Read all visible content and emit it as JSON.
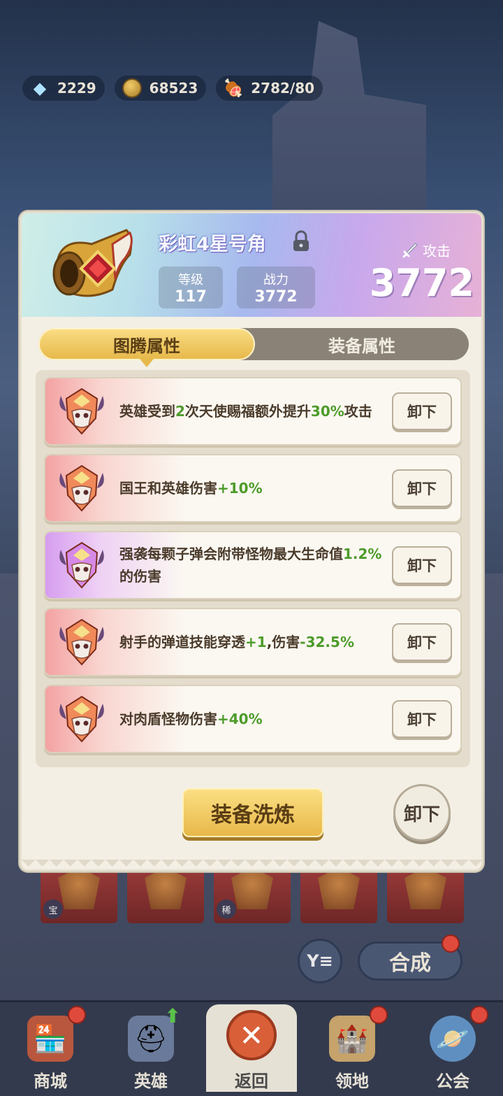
{
  "resources": {
    "gems": "2229",
    "coins": "68523",
    "stamina": "2782/80"
  },
  "item": {
    "name": "彩虹4星号角",
    "level_label": "等级",
    "level": "117",
    "power_label": "战力",
    "power": "3772",
    "attack_label": "攻击",
    "attack": "3772"
  },
  "tabs": [
    {
      "label": "图腾属性",
      "active": true
    },
    {
      "label": "装备属性",
      "active": false
    }
  ],
  "totems": [
    {
      "rarity": "red",
      "parts": [
        "英雄受到",
        "2",
        "次天使赐福额外提升",
        "30%",
        "攻击"
      ],
      "button": "卸下"
    },
    {
      "rarity": "red",
      "parts": [
        "国王和英雄伤害",
        "+10%"
      ],
      "button": "卸下"
    },
    {
      "rarity": "purple",
      "parts": [
        "强袭每颗子弹会附带怪物最大生命值",
        "1.2%",
        "的伤害"
      ],
      "button": "卸下"
    },
    {
      "rarity": "red",
      "parts": [
        "射手的弹道技能穿透",
        "+1",
        ",伤害",
        "-32.5%"
      ],
      "button": "卸下"
    },
    {
      "rarity": "red",
      "parts": [
        "对肉盾怪物伤害",
        "+40%"
      ],
      "button": "卸下"
    }
  ],
  "actions": {
    "refine": "装备洗炼",
    "unequip": "卸下"
  },
  "inventory": {
    "tags": [
      "宝",
      "",
      "稀",
      "",
      ""
    ],
    "merge": "合成"
  },
  "nav": [
    {
      "label": "商城",
      "icon": "shop-icon"
    },
    {
      "label": "英雄",
      "icon": "hero-helmet-icon"
    },
    {
      "label": "返回",
      "icon": "close-icon"
    },
    {
      "label": "领地",
      "icon": "castle-icon"
    },
    {
      "label": "公会",
      "icon": "planet-icon"
    }
  ],
  "colors": {
    "highlight_green": "#4d9b2a",
    "accent_gold": "#e8b84a",
    "rarity_red": "#f3a2a2",
    "rarity_purple": "#d69df0"
  }
}
